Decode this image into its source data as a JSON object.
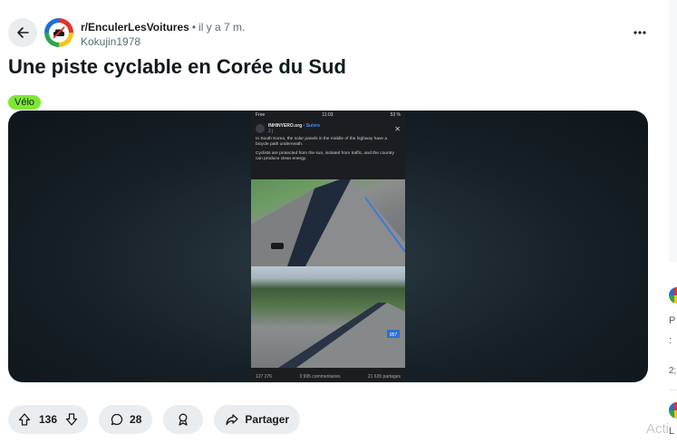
{
  "post": {
    "subreddit": "r/EnculerLesVoitures",
    "time": "il y a 7 m.",
    "author": "Kokujin1978",
    "title": "Une piste cyclable en Corée du Sud",
    "flair": "Vélo",
    "flair_color": "#7ee833"
  },
  "media": {
    "status_carrier": "Free",
    "status_time": "11:03",
    "status_battery": "53 %",
    "page_name": "INHINYERO.org",
    "follow_label": "Suivre",
    "post_age": "2 j",
    "caption_1": "In South Korea, the solar panels in the middle of the highway have a bicycle path underneath.",
    "caption_2": "Cyclists are protected from the sun, isolated from traffic, and the country can produce clean energy.",
    "road_sign": "957",
    "reactions": "127 276",
    "comments": "3 995 commentaires",
    "shares": "21 635 partages"
  },
  "actions": {
    "votes": "136",
    "comments": "28",
    "share_label": "Partager"
  },
  "sidebar": {
    "fragment_1": "P",
    "fragment_2": ":",
    "fragment_3": "2;",
    "fragment_4": "L"
  },
  "watermark": "Acti",
  "icons": [
    "arrow-left-icon",
    "more-horizontal-icon",
    "upvote-icon",
    "downvote-icon",
    "comment-icon",
    "award-icon",
    "share-icon"
  ]
}
